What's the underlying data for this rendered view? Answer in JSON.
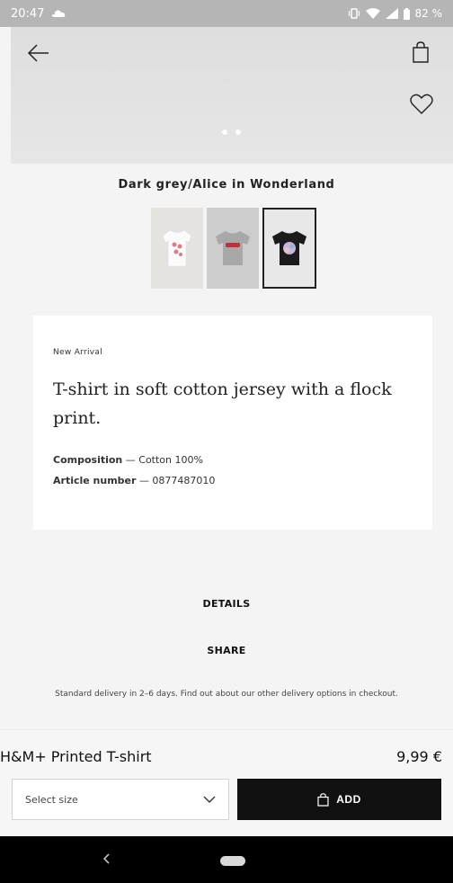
{
  "status_bar": {
    "time": "20:47",
    "battery": "82 %"
  },
  "hero": {
    "slide_count": 2,
    "active_slide": 0
  },
  "product": {
    "color_name": "Dark grey/Alice in Wonderland",
    "swatches": [
      {
        "name": "white",
        "selected": false
      },
      {
        "name": "light-grey",
        "selected": false
      },
      {
        "name": "dark-grey",
        "selected": true
      }
    ],
    "badge": "New Arrival",
    "description": "T-shirt in soft cotton jersey with a flock print.",
    "composition_label": "Composition",
    "composition_value": "— Cotton 100%",
    "article_label": "Article number",
    "article_value": "— 0877487010"
  },
  "links": {
    "details": "DETAILS",
    "share": "SHARE"
  },
  "delivery_text": "Standard delivery in 2–6 days. Find out about our other delivery options in checkout.",
  "purchase": {
    "name": "H&M+ Printed T-shirt",
    "price": "9,99 €",
    "size_placeholder": "Select size",
    "add_label": "ADD"
  },
  "colors": {
    "accent": "#111111",
    "background": "#f4f4f4",
    "card": "#ffffff"
  }
}
